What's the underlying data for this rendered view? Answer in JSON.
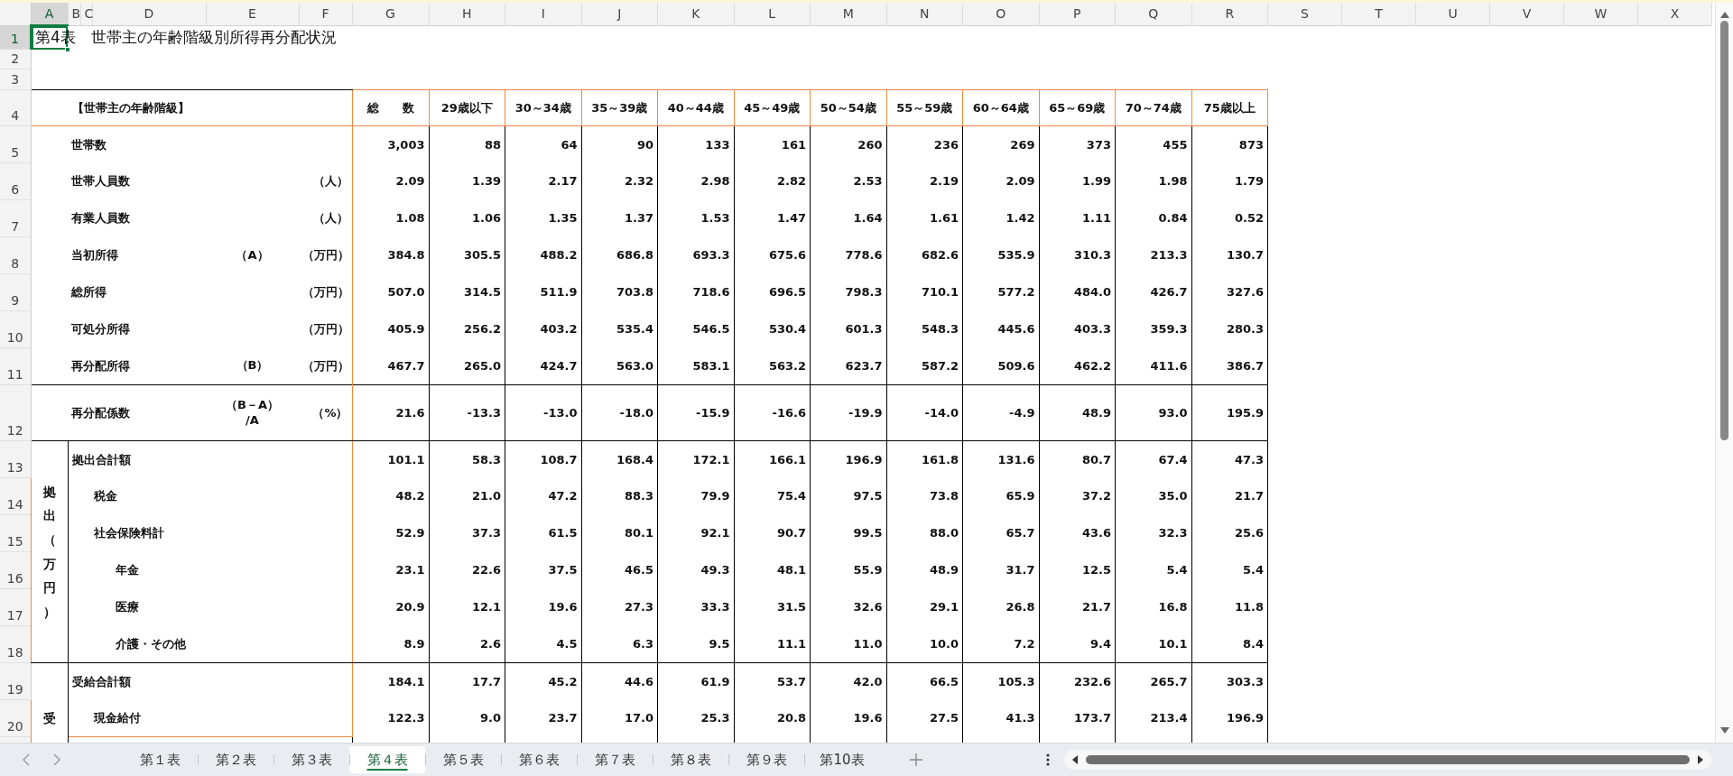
{
  "column_headers": [
    {
      "label": "A",
      "selected": true
    },
    {
      "label": "B",
      "selected": false
    },
    {
      "label": "C",
      "selected": false
    },
    {
      "label": "D",
      "selected": false
    },
    {
      "label": "E",
      "selected": false
    },
    {
      "label": "F",
      "selected": false
    },
    {
      "label": "G",
      "selected": false
    },
    {
      "label": "H",
      "selected": false
    },
    {
      "label": "I",
      "selected": false
    },
    {
      "label": "J",
      "selected": false
    },
    {
      "label": "K",
      "selected": false
    },
    {
      "label": "L",
      "selected": false
    },
    {
      "label": "M",
      "selected": false
    },
    {
      "label": "N",
      "selected": false
    },
    {
      "label": "O",
      "selected": false
    },
    {
      "label": "P",
      "selected": false
    },
    {
      "label": "Q",
      "selected": false
    },
    {
      "label": "R",
      "selected": false
    },
    {
      "label": "S",
      "selected": false
    },
    {
      "label": "T",
      "selected": false
    },
    {
      "label": "U",
      "selected": false
    },
    {
      "label": "V",
      "selected": false
    },
    {
      "label": "W",
      "selected": false
    },
    {
      "label": "X",
      "selected": false
    }
  ],
  "row_headers": [
    {
      "label": "1",
      "selected": true
    },
    {
      "label": "2",
      "selected": false
    },
    {
      "label": "3",
      "selected": false
    },
    {
      "label": "4",
      "selected": false
    },
    {
      "label": "5",
      "selected": false
    },
    {
      "label": "6",
      "selected": false
    },
    {
      "label": "7",
      "selected": false
    },
    {
      "label": "8",
      "selected": false
    },
    {
      "label": "9",
      "selected": false
    },
    {
      "label": "10",
      "selected": false
    },
    {
      "label": "11",
      "selected": false
    },
    {
      "label": "12",
      "selected": false
    },
    {
      "label": "13",
      "selected": false
    },
    {
      "label": "14",
      "selected": false
    },
    {
      "label": "15",
      "selected": false
    },
    {
      "label": "16",
      "selected": false
    },
    {
      "label": "17",
      "selected": false
    },
    {
      "label": "18",
      "selected": false
    },
    {
      "label": "19",
      "selected": false
    },
    {
      "label": "20",
      "selected": false
    }
  ],
  "title": "第4表　世帯主の年齢階級別所得再分配状況",
  "table": {
    "corner_label": "【世帯主の年齢階級】",
    "columns": [
      "総　　数",
      "29歳以下",
      "30～34歳",
      "35～39歳",
      "40～44歳",
      "45～49歳",
      "50～54歳",
      "55～59歳",
      "60～64歳",
      "65～69歳",
      "70～74歳",
      "75歳以上"
    ],
    "rows": [
      {
        "label": "世帯数",
        "values": [
          "3,003",
          "88",
          "64",
          "90",
          "133",
          "161",
          "260",
          "236",
          "269",
          "373",
          "455",
          "873"
        ]
      },
      {
        "label": "世帯人員数",
        "unit": "（人）",
        "values": [
          "2.09",
          "1.39",
          "2.17",
          "2.32",
          "2.98",
          "2.82",
          "2.53",
          "2.19",
          "2.09",
          "1.99",
          "1.98",
          "1.79"
        ]
      },
      {
        "label": "有業人員数",
        "unit": "（人）",
        "values": [
          "1.08",
          "1.06",
          "1.35",
          "1.37",
          "1.53",
          "1.47",
          "1.64",
          "1.61",
          "1.42",
          "1.11",
          "0.84",
          "0.52"
        ]
      },
      {
        "label": "当初所得",
        "note": "（A）",
        "unit": "（万円）",
        "values": [
          "384.8",
          "305.5",
          "488.2",
          "686.8",
          "693.3",
          "675.6",
          "778.6",
          "682.6",
          "535.9",
          "310.3",
          "213.3",
          "130.7"
        ]
      },
      {
        "label": "総所得",
        "unit": "（万円）",
        "values": [
          "507.0",
          "314.5",
          "511.9",
          "703.8",
          "718.6",
          "696.5",
          "798.3",
          "710.1",
          "577.2",
          "484.0",
          "426.7",
          "327.6"
        ]
      },
      {
        "label": "可処分所得",
        "unit": "（万円）",
        "values": [
          "405.9",
          "256.2",
          "403.2",
          "535.4",
          "546.5",
          "530.4",
          "601.3",
          "548.3",
          "445.6",
          "403.3",
          "359.3",
          "280.3"
        ]
      },
      {
        "label": "再分配所得",
        "note": "（B）",
        "unit": "（万円）",
        "values": [
          "467.7",
          "265.0",
          "424.7",
          "563.0",
          "583.1",
          "563.2",
          "623.7",
          "587.2",
          "509.6",
          "462.2",
          "411.6",
          "386.7"
        ]
      }
    ],
    "coefficient": {
      "label": "再分配係数",
      "note": "（B－A）\n/A",
      "unit": "（%）",
      "values": [
        "21.6",
        "-13.3",
        "-13.0",
        "-18.0",
        "-15.9",
        "-16.6",
        "-19.9",
        "-14.0",
        "-4.9",
        "48.9",
        "93.0",
        "195.9"
      ]
    },
    "groups": [
      {
        "label": "拠出（万円）",
        "rows": [
          {
            "label": "拠出合計額",
            "values": [
              "101.1",
              "58.3",
              "108.7",
              "168.4",
              "172.1",
              "166.1",
              "196.9",
              "161.8",
              "131.6",
              "80.7",
              "67.4",
              "47.3"
            ],
            "children": [
              {
                "label": "税金",
                "values": [
                  "48.2",
                  "21.0",
                  "47.2",
                  "88.3",
                  "79.9",
                  "75.4",
                  "97.5",
                  "73.8",
                  "65.9",
                  "37.2",
                  "35.0",
                  "21.7"
                ]
              },
              {
                "label": "社会保険料計",
                "values": [
                  "52.9",
                  "37.3",
                  "61.5",
                  "80.1",
                  "92.1",
                  "90.7",
                  "99.5",
                  "88.0",
                  "65.7",
                  "43.6",
                  "32.3",
                  "25.6"
                ],
                "children": [
                  {
                    "label": "年金",
                    "values": [
                      "23.1",
                      "22.6",
                      "37.5",
                      "46.5",
                      "49.3",
                      "48.1",
                      "55.9",
                      "48.9",
                      "31.7",
                      "12.5",
                      "5.4",
                      "5.4"
                    ]
                  },
                  {
                    "label": "医療",
                    "values": [
                      "20.9",
                      "12.1",
                      "19.6",
                      "27.3",
                      "33.3",
                      "31.5",
                      "32.6",
                      "29.1",
                      "26.8",
                      "21.7",
                      "16.8",
                      "11.8"
                    ]
                  },
                  {
                    "label": "介護・その他",
                    "values": [
                      "8.9",
                      "2.6",
                      "4.5",
                      "6.3",
                      "9.5",
                      "11.1",
                      "11.0",
                      "10.0",
                      "7.2",
                      "9.4",
                      "10.1",
                      "8.4"
                    ]
                  }
                ]
              }
            ]
          }
        ]
      },
      {
        "label": "受",
        "rows": [
          {
            "label": "受給合計額",
            "values": [
              "184.1",
              "17.7",
              "45.2",
              "44.6",
              "61.9",
              "53.7",
              "42.0",
              "66.5",
              "105.3",
              "232.6",
              "265.7",
              "303.3"
            ],
            "children": [
              {
                "label": "現金給付",
                "values": [
                  "122.3",
                  "9.0",
                  "23.7",
                  "17.0",
                  "25.3",
                  "20.8",
                  "19.6",
                  "27.5",
                  "41.3",
                  "173.7",
                  "213.4",
                  "196.9"
                ]
              }
            ]
          }
        ]
      }
    ]
  },
  "sheet_tabs": [
    {
      "label": "第１表",
      "selected": false
    },
    {
      "label": "第２表",
      "selected": false
    },
    {
      "label": "第３表",
      "selected": false
    },
    {
      "label": "第４表",
      "selected": true
    },
    {
      "label": "第５表",
      "selected": false
    },
    {
      "label": "第６表",
      "selected": false
    },
    {
      "label": "第７表",
      "selected": false
    },
    {
      "label": "第８表",
      "selected": false
    },
    {
      "label": "第９表",
      "selected": false
    },
    {
      "label": "第10表",
      "selected": false
    }
  ]
}
